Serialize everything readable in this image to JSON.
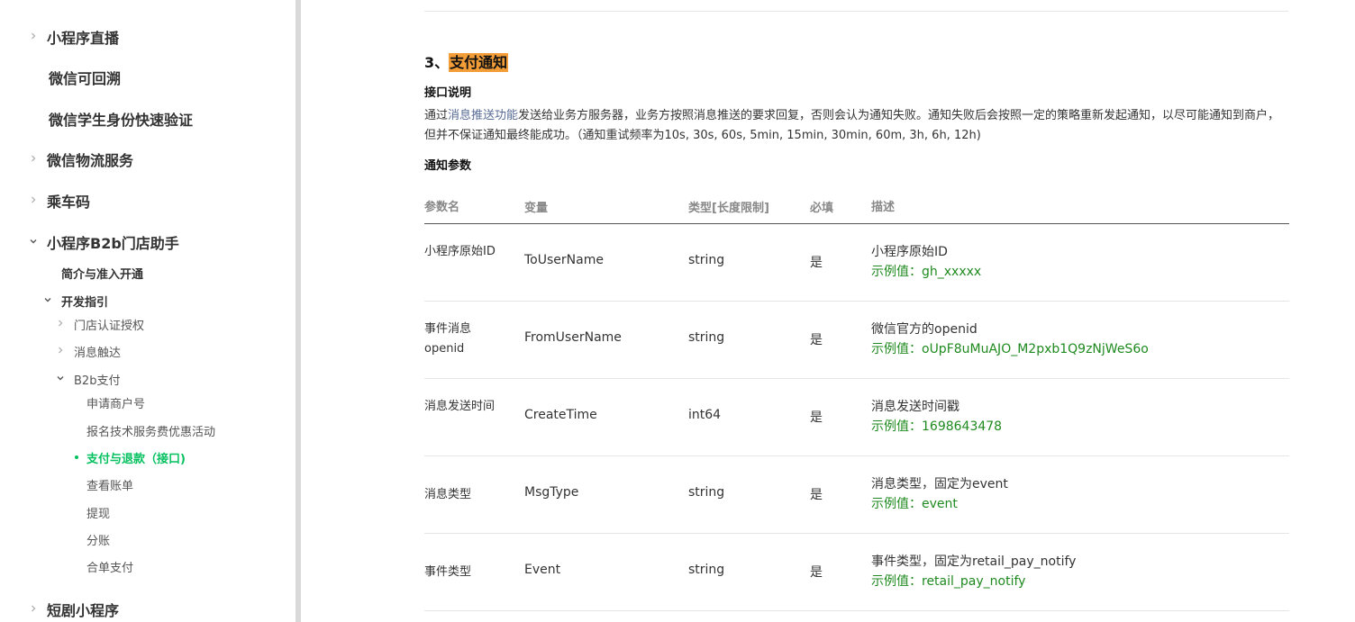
{
  "sidebar": {
    "items_l1": [
      {
        "label": "小程序直播",
        "chevron": "right"
      },
      {
        "label": "微信可回溯",
        "chevron": "none"
      },
      {
        "label": "微信学生身份快速验证",
        "chevron": "none"
      },
      {
        "label": "微信物流服务",
        "chevron": "right"
      },
      {
        "label": "乘车码",
        "chevron": "right"
      },
      {
        "label": "小程序B2b门店助手",
        "chevron": "down"
      }
    ],
    "b2b": {
      "intro": "简介与准入开通",
      "dev_guide": "开发指引",
      "store_auth": "门店认证授权",
      "message_reach": "消息触达",
      "b2b_pay": "B2b支付",
      "pay_children": [
        "申请商户号",
        "报名技术服务费优惠活动",
        "支付与退款（接口)",
        "查看账单",
        "提现",
        "分账",
        "合单支付"
      ]
    },
    "short_drama": "短剧小程序"
  },
  "main": {
    "section_number": "3、",
    "section_title": "支付通知",
    "interface_desc_heading": "接口说明",
    "desc_prefix": "通过",
    "desc_link": "消息推送功能",
    "desc_rest": "发送给业务方服务器，业务方按照消息推送的要求回复，否则会认为通知失败。通知失败后会按照一定的策略重新发起通知，以尽可能通知到商户，但并不保证通知最终能成功。（通知重试频率为10s, 30s, 60s, 5min, 15min, 30min, 60m, 3h, 6h, 12h)",
    "notify_params_heading": "通知参数",
    "table": {
      "headers": [
        "参数名",
        "变量",
        "类型[长度限制]",
        "必填",
        "描述"
      ],
      "rows": [
        {
          "name": "小程序原始ID",
          "var": "ToUserName",
          "type": "string",
          "required": "是",
          "desc": "小程序原始ID",
          "example": "示例值：gh_xxxxx"
        },
        {
          "name": "事件消息openid",
          "var": "FromUserName",
          "type": "string",
          "required": "是",
          "desc": "微信官方的openid",
          "example": "示例值：oUpF8uMuAJO_M2pxb1Q9zNjWeS6o"
        },
        {
          "name": "消息发送时间",
          "var": "CreateTime",
          "type": "int64",
          "required": "是",
          "desc": "消息发送时间戳",
          "example": "示例值：1698643478"
        },
        {
          "name": "消息类型",
          "var": "MsgType",
          "type": "string",
          "required": "是",
          "desc": "消息类型，固定为event",
          "example": "示例值：event"
        },
        {
          "name": "事件类型",
          "var": "Event",
          "type": "string",
          "required": "是",
          "desc": "事件类型，固定为retail_pay_notify",
          "example": "示例值：retail_pay_notify"
        }
      ]
    }
  },
  "colors": {
    "accent_green": "#07c160",
    "example_green": "#1f8a1f",
    "link": "#576b95",
    "highlight": "#f29d38"
  }
}
